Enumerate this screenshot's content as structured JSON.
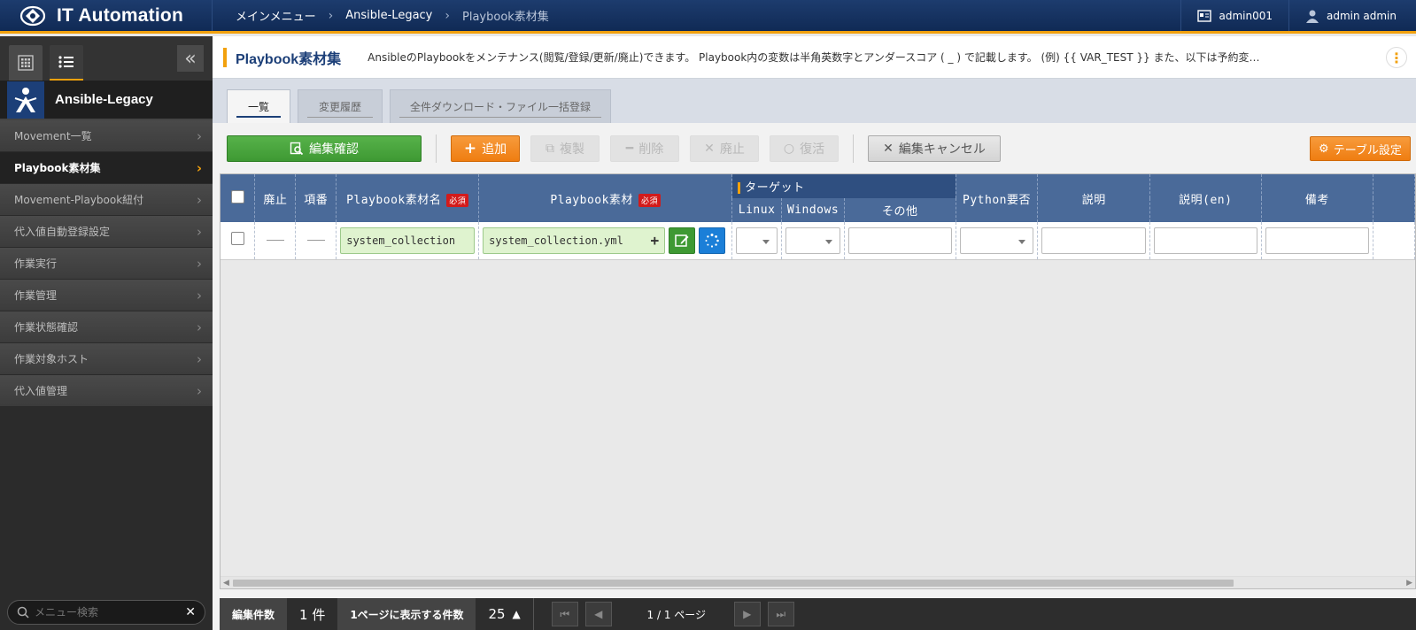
{
  "header": {
    "app_title": "IT Automation",
    "breadcrumb": [
      "メインメニュー",
      "Ansible-Legacy",
      "Playbook素材集"
    ],
    "user_id": "admin001",
    "user_name": "admin admin"
  },
  "sidebar": {
    "group_label": "Ansible-Legacy",
    "items": [
      {
        "label": "Movement一覧"
      },
      {
        "label": "Playbook素材集"
      },
      {
        "label": "Movement-Playbook紐付"
      },
      {
        "label": "代入値自動登録設定"
      },
      {
        "label": "作業実行"
      },
      {
        "label": "作業管理"
      },
      {
        "label": "作業状態確認"
      },
      {
        "label": "作業対象ホスト"
      },
      {
        "label": "代入値管理"
      }
    ],
    "search_placeholder": "メニュー検索"
  },
  "page": {
    "title": "Playbook素材集",
    "description": "AnsibleのPlaybookをメンテナンス(閲覧/登録/更新/廃止)できます。 Playbook内の変数は半角英数字とアンダースコア ( _ ) で記載します。 (例) {{ VAR_TEST }} また、以下は予約変…"
  },
  "tabs": [
    "一覧",
    "変更履歴",
    "全件ダウンロード・ファイル一括登録"
  ],
  "toolbar": {
    "confirm": "編集確認",
    "add": "追加",
    "copy": "複製",
    "delete": "削除",
    "discard": "廃止",
    "restore": "復活",
    "cancel": "編集キャンセル",
    "table_settings": "テーブル設定"
  },
  "table": {
    "headers": {
      "discard": "廃止",
      "item_no": "項番",
      "playbook_name": "Playbook素材名",
      "playbook_file": "Playbook素材",
      "target": "ターゲット",
      "linux": "Linux",
      "windows": "Windows",
      "other": "その他",
      "python": "Python要否",
      "desc": "説明",
      "desc_en": "説明(en)",
      "remarks": "備考"
    },
    "required_label": "必須",
    "row": {
      "playbook_name": "system_collection",
      "playbook_file": "system_collection.yml"
    }
  },
  "footer": {
    "edit_count_label": "編集件数",
    "edit_count_value": "1 件",
    "per_page_label": "1ページに表示する件数",
    "per_page_value": "25",
    "page_info": "1 / 1 ページ"
  },
  "colors": {
    "header_bg": "#102a55",
    "accent": "#f2a10d",
    "green": "#3e9933",
    "orange": "#ef7d11",
    "table_header": "#4a6a99"
  }
}
